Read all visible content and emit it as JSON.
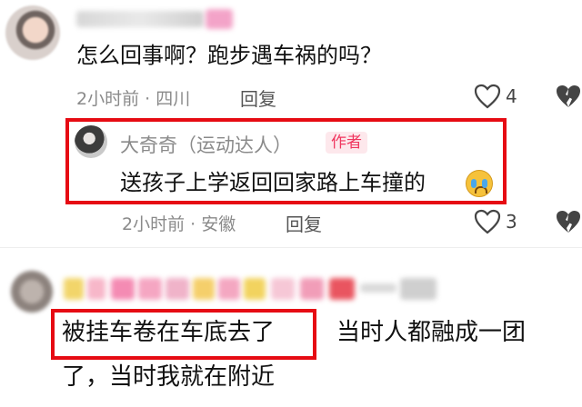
{
  "comment1": {
    "text": "怎么回事啊？跑步遇车祸的吗？",
    "time_location": "2小时前 · 四川",
    "reply_label": "回复",
    "like_count": "4"
  },
  "author_reply": {
    "name": "大奇奇（运动达人）",
    "badge": "作者",
    "text": "送孩子上学返回回家路上车撞的",
    "time_location": "2小时前 · 安徽",
    "reply_label": "回复",
    "like_count": "3"
  },
  "comment2": {
    "text_highlight": "被挂车卷在车底去了",
    "text_rest": "当时人都融成一团",
    "text_line2": "了，当时我就在附近"
  },
  "colors": {
    "highlight_border": "#e60b13",
    "badge_text": "#f0365f",
    "badge_bg": "#fde8ec"
  },
  "icons": [
    "heart-outline-icon",
    "broken-heart-icon",
    "crying-emoji-icon"
  ]
}
